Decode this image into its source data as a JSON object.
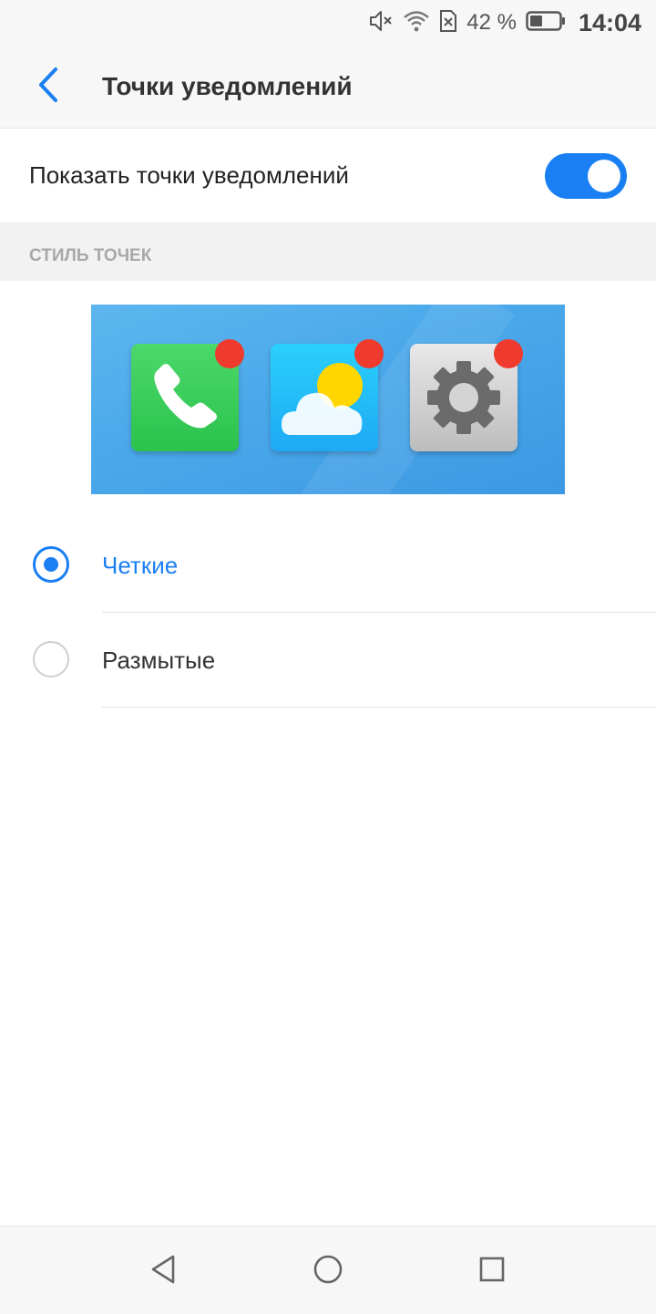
{
  "status_bar": {
    "battery_percent": "42 %",
    "battery_level": 0.42,
    "time": "14:04",
    "icons": [
      "volume-mute-icon",
      "wifi-icon",
      "no-sim-icon",
      "battery-icon"
    ]
  },
  "header": {
    "title": "Точки уведомлений",
    "back_icon": "chevron-left-icon"
  },
  "toggle": {
    "label": "Показать точки уведомлений",
    "state": "on"
  },
  "section": {
    "title": "СТИЛЬ ТОЧЕК"
  },
  "preview": {
    "icons": [
      "phone-app-icon",
      "weather-app-icon",
      "settings-app-icon"
    ],
    "badge_color": "#ef3b2d"
  },
  "options": [
    {
      "label": "Четкие",
      "selected": true
    },
    {
      "label": "Размытые",
      "selected": false
    }
  ],
  "nav_bar": {
    "icons": [
      "back-triangle-icon",
      "home-circle-icon",
      "recents-square-icon"
    ]
  },
  "colors": {
    "accent": "#1a7ff2",
    "badge": "#ef3b2d"
  }
}
